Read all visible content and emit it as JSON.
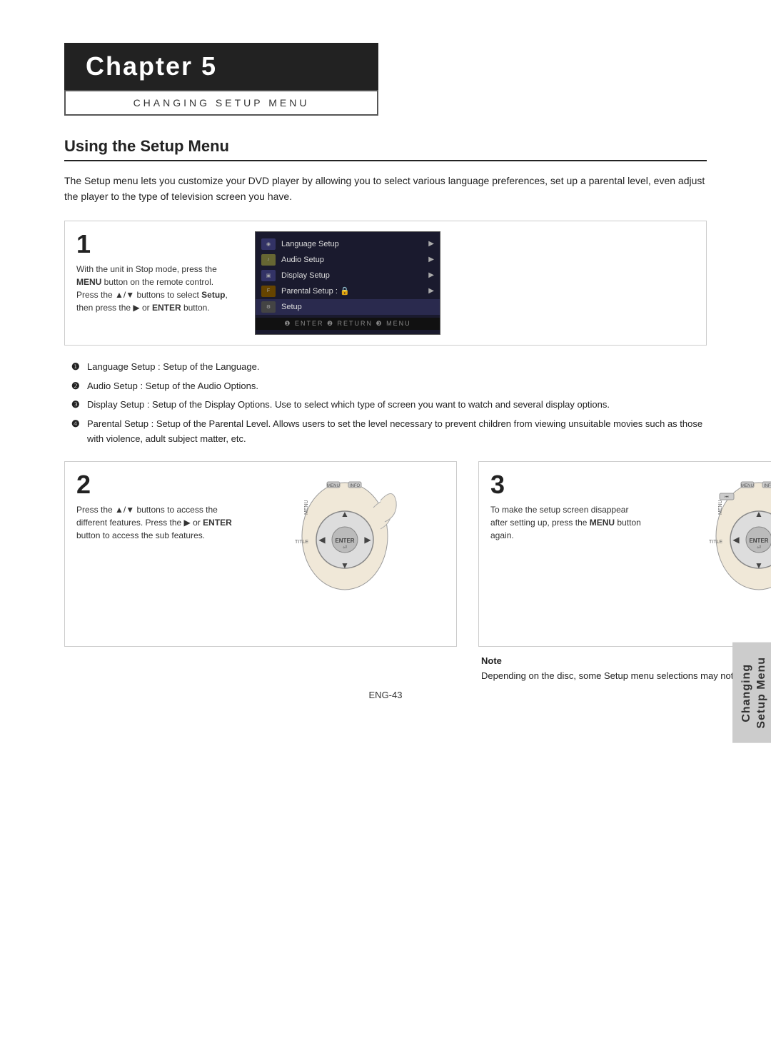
{
  "chapter": {
    "title": "Chapter 5",
    "subtitle": "Changing Setup Menu"
  },
  "section": {
    "heading": "Using the Setup Menu"
  },
  "intro": "The Setup menu lets you customize your DVD player by allowing you to select various language preferences, set up a parental level, even adjust the player to the type of television screen you have.",
  "step1": {
    "number": "1",
    "text_parts": [
      "With the unit in Stop mode, press the ",
      "MENU",
      " button on the remote control.",
      "\nPress the ▲/▼ buttons to select ",
      "Setup",
      ", then press the ▶ or ",
      "ENTER",
      " button."
    ],
    "menu_items": [
      {
        "label": "Language Setup",
        "icon": "disc",
        "arrow": "▶"
      },
      {
        "label": "Audio Setup",
        "icon": "audio",
        "arrow": "▶"
      },
      {
        "label": "Display Setup",
        "icon": "display",
        "arrow": "▶"
      },
      {
        "label": "Parental Setup :",
        "icon": "function",
        "arrow": "▶",
        "lock": "🔒"
      }
    ],
    "menu_selected": "Setup",
    "menu_bottom": "❶ ENTER  ❷ RETURN  ❸ MENU"
  },
  "features": [
    {
      "number": "❶",
      "text": "Language Setup : Setup of the Language."
    },
    {
      "number": "❷",
      "text": "Audio Setup : Setup of the Audio Options."
    },
    {
      "number": "❸",
      "text": "Display Setup : Setup of the Display Options. Use to select which type of screen you want to watch and several display options."
    },
    {
      "number": "❹",
      "text": "Parental Setup : Setup of the Parental Level. Allows users to set the level necessary to prevent children from viewing unsuitable movies such as those with violence, adult subject matter, etc."
    }
  ],
  "step2": {
    "number": "2",
    "text_parts": [
      "Press the ▲/▼ buttons to access the different features. Press the ▶ or ",
      "ENTER",
      " button to access the sub features."
    ]
  },
  "step3": {
    "number": "3",
    "text_parts": [
      "To make the setup screen disappear after setting up, press the ",
      "MENU",
      " button again."
    ]
  },
  "note": {
    "title": "Note",
    "text": "Depending on the disc, some Setup menu selections may not work."
  },
  "side_tab": {
    "lines": [
      "Changing",
      "Setup Menu"
    ]
  },
  "page_number": "ENG-43"
}
